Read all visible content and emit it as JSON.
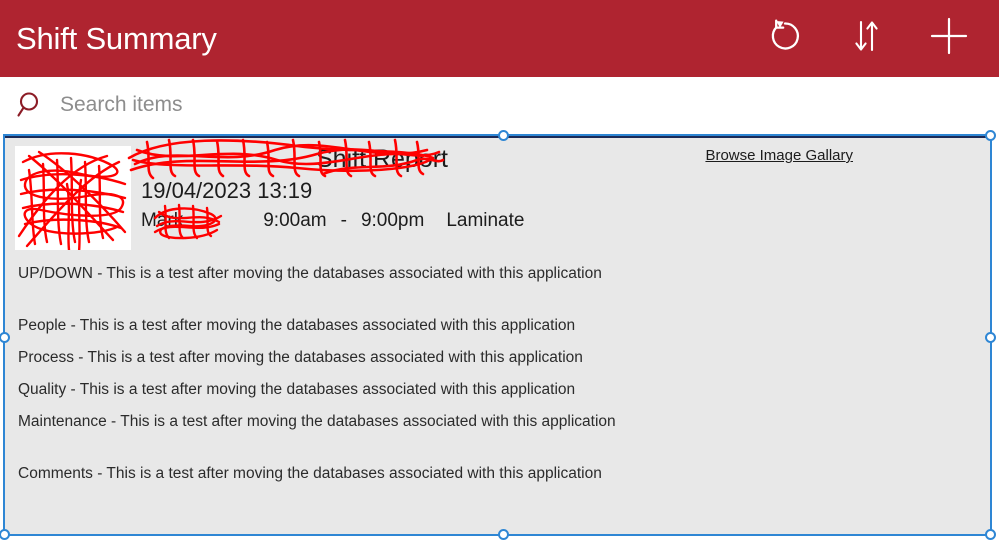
{
  "appbar": {
    "title": "Shift Summary",
    "actions": [
      {
        "name": "refresh-button",
        "icon": "refresh-icon",
        "label": "Refresh"
      },
      {
        "name": "sort-button",
        "icon": "sort-up-down-icon",
        "label": "Sort"
      },
      {
        "name": "add-button",
        "icon": "plus-icon",
        "label": "Add"
      }
    ]
  },
  "search": {
    "icon": "search-icon",
    "placeholder": "Search items",
    "value": ""
  },
  "colors": {
    "appbar_red": "#AF2430",
    "search_icon_red": "#8C1C26",
    "panel_background": "#E8E8E8",
    "selection_blue": "#2E86D4",
    "rule_navy": "#1B2A57",
    "redaction_red": "#FF0000",
    "body_text": "#2B2B2B"
  },
  "report": {
    "thumbnail": {
      "name": "report-thumbnail",
      "redacted": true
    },
    "title": "Shift Report",
    "title_redacted_prefix": "[redacted]",
    "date": "19/04/2023 13:19",
    "author": "Mark",
    "author_redacted_surname": "[redacted]",
    "shift_start": "9:00am",
    "shift_separator": "-",
    "shift_end": "9:00pm",
    "line_name": "Laminate",
    "gallery_link": "Browse Image Gallary",
    "lines": [
      {
        "text": "UP/DOWN - This is a test after moving the databases associated with this application",
        "spacing": "none"
      },
      {
        "text": "People - This is a test after moving the databases associated with this application",
        "spacing": "large"
      },
      {
        "text": "Process - This is a test after moving the databases associated with this application",
        "spacing": "none"
      },
      {
        "text": "Quality - This is a test after moving the databases associated with this application",
        "spacing": "none"
      },
      {
        "text": "Maintenance - This is a test after moving the databases associated with this application",
        "spacing": "none"
      },
      {
        "text": "Comments - This is a test after moving the databases associated with this application",
        "spacing": "large"
      }
    ]
  }
}
